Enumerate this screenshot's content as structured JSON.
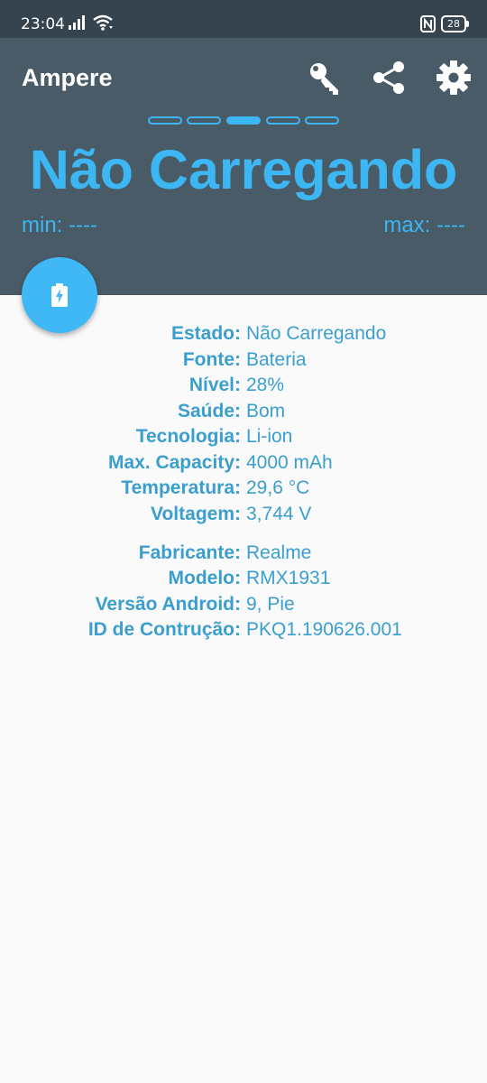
{
  "status_bar": {
    "time": "23:04",
    "battery_level": "28",
    "icons": [
      "signal-icon",
      "wifi-icon",
      "nfc-icon",
      "battery-icon"
    ]
  },
  "header": {
    "app_title": "Ampere",
    "actions": [
      "key-icon",
      "share-icon",
      "gear-icon"
    ],
    "page_count": 5,
    "active_page": 3,
    "charging_status": "Não Carregando",
    "min_label": "min: ----",
    "max_label": "max: ----",
    "fab_icon": "battery-charging-icon"
  },
  "battery_info": [
    {
      "label": "Estado:",
      "value": "Não Carregando"
    },
    {
      "label": "Fonte:",
      "value": "Bateria"
    },
    {
      "label": "Nível:",
      "value": "28%"
    },
    {
      "label": "Saúde:",
      "value": "Bom"
    },
    {
      "label": "Tecnologia:",
      "value": "Li-ion"
    },
    {
      "label": "Max. Capacity:",
      "value": "4000 mAh"
    },
    {
      "label": "Temperatura:",
      "value": "29,6 °C"
    },
    {
      "label": "Voltagem:",
      "value": "3,744 V"
    }
  ],
  "device_info": [
    {
      "label": "Fabricante:",
      "value": "Realme"
    },
    {
      "label": "Modelo:",
      "value": "RMX1931"
    },
    {
      "label": "Versão Android:",
      "value": "9, Pie"
    },
    {
      "label": "ID de Contrução:",
      "value": "PKQ1.190626.001"
    }
  ],
  "colors": {
    "status_bar": "#36444f",
    "header": "#485b67",
    "accent": "#3db7f4",
    "info_text": "#3a9fcf",
    "background": "#fafafa"
  }
}
